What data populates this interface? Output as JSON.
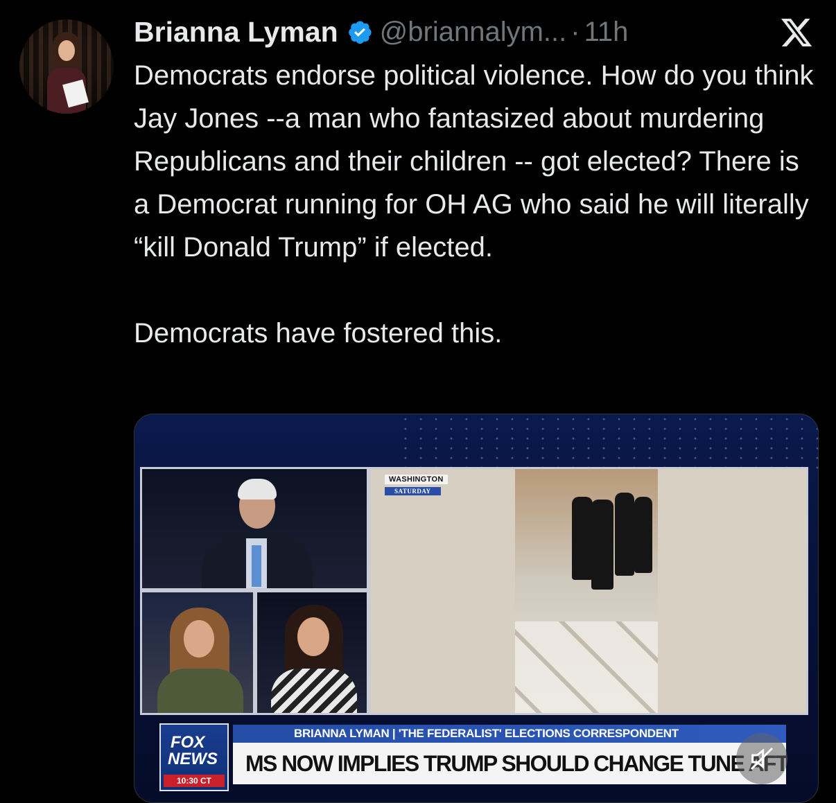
{
  "author": {
    "name": "Brianna Lyman",
    "handle": "@briannalym...",
    "separator": "·",
    "time": "11h",
    "verified": true
  },
  "platform_icon": "x-logo-icon",
  "tweet": {
    "paragraph1": "Democrats endorse political violence.  How do you think Jay Jones --a man who fantasized about murdering Republicans and their children -- got elected? There is a Democrat running for OH AG who said he will literally “kill Donald Trump” if elected.",
    "paragraph2": "Democrats have fostered this."
  },
  "media": {
    "location_tag": "WASHINGTON",
    "day_tag": "SATURDAY",
    "logo_line1": "FOX",
    "logo_line2": "NEWS",
    "clock": "10:30 CT",
    "banner_top": "BRIANNA LYMAN | 'THE FEDERALIST' ELECTIONS CORRESPONDENT",
    "banner_main": "MS NOW IMPLIES TRUMP SHOULD CHANGE TUNE AFTER WHO",
    "mute_icon": "muted-speaker-icon"
  },
  "colors": {
    "background": "#000000",
    "text": "#e7e9ea",
    "secondary_text": "#71767b",
    "verified_blue": "#1d9bf0"
  }
}
